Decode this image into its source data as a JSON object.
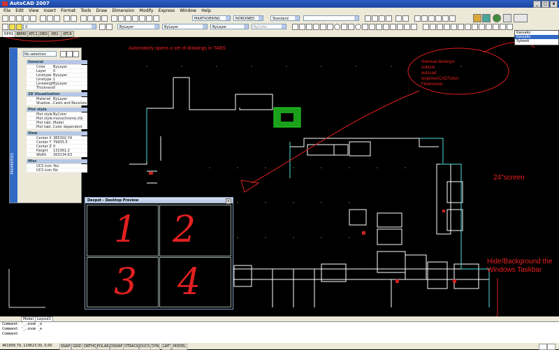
{
  "window": {
    "title": "AutoCAD 2007",
    "min": "_",
    "max": "□",
    "close": "x"
  },
  "menu": [
    "File",
    "Edit",
    "View",
    "Insert",
    "Format",
    "Tools",
    "Draw",
    "Dimension",
    "Modify",
    "Express",
    "Window",
    "Help"
  ],
  "toolbar": {
    "dimstyle": "MAATVOERING",
    "textstyle": "NORDINED",
    "tablestyle": "Standard",
    "layer": "0",
    "color": "ByLayer",
    "linetype": "ByLayer",
    "lineweight": "ByLayer",
    "plotstyle": "ByColor"
  },
  "drawing_tabs": [
    "DPH1",
    "BEM0",
    "KTC1",
    "DEO",
    "DE1",
    "KTC6"
  ],
  "layer_dropdown": {
    "items": [
      "Kassako",
      "Kassako",
      "Sybeek"
    ],
    "selected_index": 1
  },
  "properties": {
    "strip": "PROPERTIES",
    "selection": "No selection",
    "sections": [
      {
        "name": "General",
        "rows": [
          [
            "Color",
            "ByLayer"
          ],
          [
            "Layer",
            "0"
          ],
          [
            "Linetype",
            "ByLayer"
          ],
          [
            "Linetype ...",
            "1"
          ],
          [
            "Lineweight",
            "ByLayer"
          ],
          [
            "Thickness",
            "0"
          ]
        ]
      },
      {
        "name": "3D Visualization",
        "rows": [
          [
            "Material",
            "ByLayer"
          ],
          [
            "Shadow ...",
            "Casts and Receives ..."
          ]
        ]
      },
      {
        "name": "Plot style",
        "rows": [
          [
            "Plot style",
            "ByColor"
          ],
          [
            "Plot style ...",
            "monochrome.ctb"
          ],
          [
            "Plot tabl...",
            "Model"
          ],
          [
            "Plot tabl...",
            "Color dependent"
          ]
        ]
      },
      {
        "name": "View",
        "rows": [
          [
            "Center X",
            "385302.74"
          ],
          [
            "Center Y",
            "79935.5"
          ],
          [
            "Center Z",
            "0"
          ],
          [
            "Height",
            "131361.2"
          ],
          [
            "Width",
            "263134.63"
          ]
        ]
      },
      {
        "name": "Misc",
        "rows": [
          [
            "UCS icon ...",
            "Yes"
          ],
          [
            "UCS icon ...",
            "No"
          ]
        ]
      }
    ]
  },
  "dexpot": {
    "title": "Dexpot - Desktop Preview",
    "close": "x",
    "desktops": [
      "1",
      "2",
      "3",
      "4"
    ]
  },
  "annotations": {
    "tabs": "Automaticly opens a set of drawings in TABS",
    "desktops": [
      "4Vertual desktops",
      "outlook",
      "autocad",
      "iexplorer(CADTutor)",
      "Filebrowser"
    ],
    "screen": "24\"screen",
    "taskbar": [
      "Hide/Background the",
      "Windows Taskbar"
    ]
  },
  "layout_tabs": [
    "Model",
    "Layout1"
  ],
  "command": {
    "lines": [
      "Command: '_.zoom _e",
      "Command: '_.zoom _e",
      "Command:"
    ]
  },
  "status": {
    "coords": "461958.79, 129623.00, 0.00",
    "toggles": [
      "SNAP",
      "GRID",
      "ORTHO",
      "POLAR",
      "OSNAP",
      "OTRACK",
      "DUCS",
      "DYN",
      "LWT",
      "MODEL"
    ]
  },
  "colors": {
    "canvas": "#000000",
    "annotation": "#ee2020",
    "window_title": "#2b5fc4"
  }
}
